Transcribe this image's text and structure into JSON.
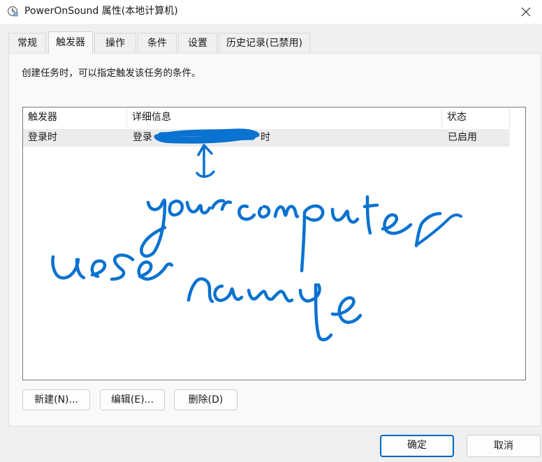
{
  "window": {
    "title": "PowerOnSound 属性(本地计算机)",
    "icon": "task-scheduler-clock-icon"
  },
  "tabs": [
    {
      "label": "常规",
      "active": false
    },
    {
      "label": "触发器",
      "active": true
    },
    {
      "label": "操作",
      "active": false
    },
    {
      "label": "条件",
      "active": false
    },
    {
      "label": "设置",
      "active": false
    },
    {
      "label": "历史记录(已禁用)",
      "active": false
    }
  ],
  "triggers": {
    "description": "创建任务时，可以指定触发该任务的条件。",
    "columns": [
      "触发器",
      "详细信息",
      "状态"
    ],
    "rows": [
      {
        "trigger": "登录时",
        "details_prefix": "登录",
        "details_suffix": "时",
        "status": "已启用"
      }
    ],
    "annotation": {
      "handwritten_text": "your computer user name",
      "ink_color": "#0a72d0"
    },
    "buttons": {
      "new": "新建(N)...",
      "edit": "编辑(E)...",
      "delete": "删除(D)"
    }
  },
  "dialog_buttons": {
    "ok": "确定",
    "cancel": "取消"
  }
}
